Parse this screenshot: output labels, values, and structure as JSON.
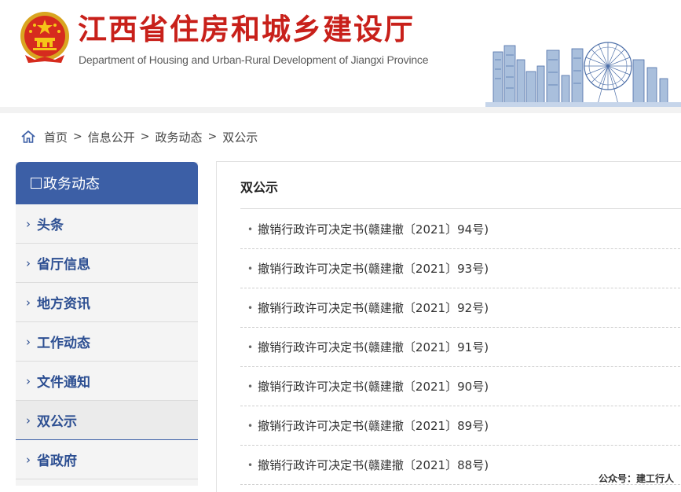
{
  "header": {
    "title": "江西省住房和城乡建设厅",
    "subtitle": "Department of Housing and Urban-Rural Development of Jiangxi Province",
    "title_color": "#c8201a"
  },
  "breadcrumb": [
    "首页",
    "信息公开",
    "政务动态",
    "双公示"
  ],
  "sidebar": {
    "heading": "政务动态",
    "heading_bg": "#3c5fa6",
    "items": [
      {
        "label": "头条"
      },
      {
        "label": "省厅信息"
      },
      {
        "label": "地方资讯"
      },
      {
        "label": "工作动态"
      },
      {
        "label": "文件通知"
      },
      {
        "label": "双公示",
        "active": true
      },
      {
        "label": "省政府"
      }
    ]
  },
  "content": {
    "title": "双公示",
    "items": [
      "撤销行政许可决定书(赣建撤〔2021〕94号)",
      "撤销行政许可决定书(赣建撤〔2021〕93号)",
      "撤销行政许可决定书(赣建撤〔2021〕92号)",
      "撤销行政许可决定书(赣建撤〔2021〕91号)",
      "撤销行政许可决定书(赣建撤〔2021〕90号)",
      "撤销行政许可决定书(赣建撤〔2021〕89号)",
      "撤销行政许可决定书(赣建撤〔2021〕88号)"
    ]
  },
  "watermark": "公众号：建工行人"
}
